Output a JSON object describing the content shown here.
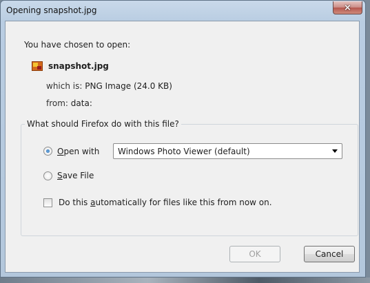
{
  "window": {
    "title": "Opening snapshot.jpg",
    "close_glyph": "⨯"
  },
  "dialog": {
    "heading": "You have chosen to open:",
    "file_icon": "image-file-icon",
    "file_name": "snapshot.jpg",
    "which_is_label": "which is:",
    "which_is_value": "PNG Image (24.0 KB)",
    "from_label": "from:",
    "from_value": "data:",
    "group_legend": "What should Firefox do with this file?",
    "open_with_prefix": "",
    "open_with_accel": "O",
    "open_with_rest": "pen with",
    "open_with_selected": true,
    "open_with_app": "Windows Photo Viewer (default)",
    "save_file_accel": "S",
    "save_file_rest": "ave File",
    "save_file_selected": false,
    "auto_prefix": "Do this ",
    "auto_accel": "a",
    "auto_rest": "utomatically for files like this from now on.",
    "auto_checked": false,
    "ok_label": "OK",
    "cancel_label": "Cancel"
  },
  "colors": {
    "accent": "#1c5ea8",
    "close_button": "#c46a60"
  }
}
